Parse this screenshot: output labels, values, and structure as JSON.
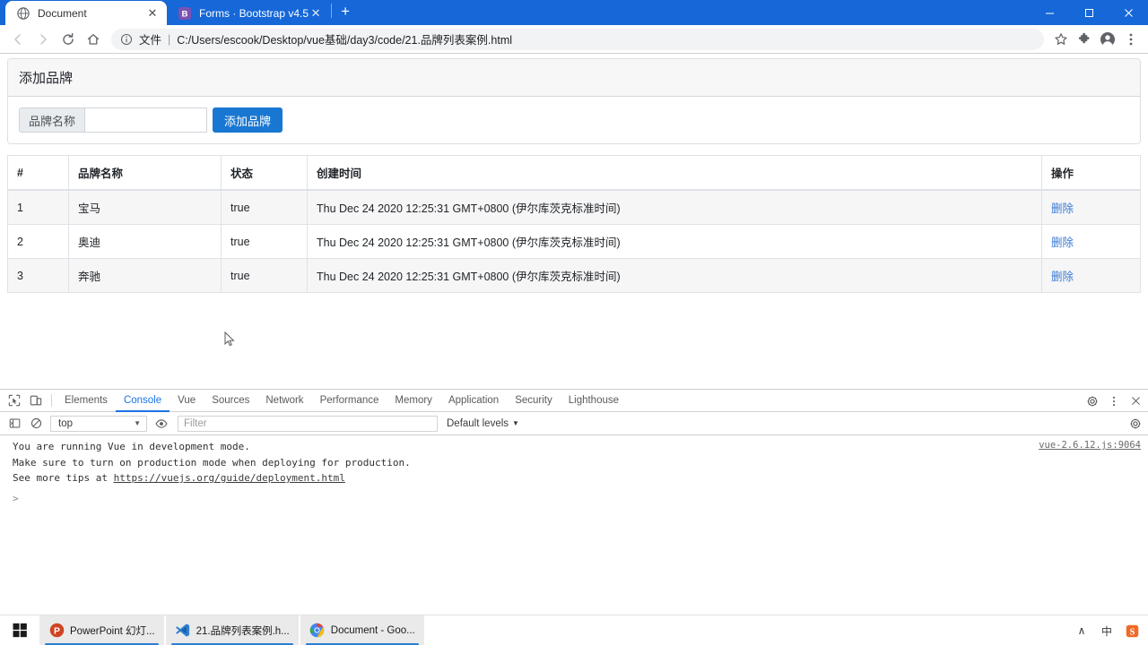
{
  "browser": {
    "tabs": [
      {
        "title": "Document",
        "favicon": "globe-icon",
        "active": true
      },
      {
        "title": "Forms · Bootstrap v4.5",
        "favicon": "bootstrap-icon",
        "active": false
      }
    ],
    "new_tab_label": "+",
    "window_controls": {
      "minimize": "–",
      "maximize": "❐",
      "close": "×"
    },
    "nav": {
      "back": "←",
      "forward": "→",
      "reload": "⟳",
      "home": "⌂"
    },
    "omnibox": {
      "scheme_label": "文件",
      "divider": "|",
      "url": "C:/Users/escook/Desktop/vue基础/day3/code/21.品牌列表案例.html"
    },
    "toolbar_icons": [
      "bookmark-star-icon",
      "extensions-puzzle-icon",
      "profile-avatar-icon",
      "chrome-menu-icon"
    ]
  },
  "page": {
    "card": {
      "header_title": "添加品牌",
      "input_label": "品牌名称",
      "input_value": "",
      "input_placeholder": "",
      "submit_label": "添加品牌"
    },
    "table": {
      "columns": [
        "#",
        "品牌名称",
        "状态",
        "创建时间",
        "操作"
      ],
      "action_label": "删除",
      "rows": [
        {
          "index": "1",
          "name": "宝马",
          "state": "true",
          "time": "Thu Dec 24 2020 12:25:31 GMT+0800 (伊尔库茨克标准时间)",
          "action": "删除"
        },
        {
          "index": "2",
          "name": "奥迪",
          "state": "true",
          "time": "Thu Dec 24 2020 12:25:31 GMT+0800 (伊尔库茨克标准时间)",
          "action": "删除"
        },
        {
          "index": "3",
          "name": "奔驰",
          "state": "true",
          "time": "Thu Dec 24 2020 12:25:31 GMT+0800 (伊尔库茨克标准时间)",
          "action": "删除"
        }
      ]
    }
  },
  "devtools": {
    "tabs": [
      {
        "label": "Elements",
        "active": false
      },
      {
        "label": "Console",
        "active": true
      },
      {
        "label": "Vue",
        "active": false
      },
      {
        "label": "Sources",
        "active": false
      },
      {
        "label": "Network",
        "active": false
      },
      {
        "label": "Performance",
        "active": false
      },
      {
        "label": "Memory",
        "active": false
      },
      {
        "label": "Application",
        "active": false
      },
      {
        "label": "Security",
        "active": false
      },
      {
        "label": "Lighthouse",
        "active": false
      }
    ],
    "header_icons": [
      "inspect-element-icon",
      "device-toolbar-icon"
    ],
    "right_icons": [
      "settings-gear-icon",
      "more-options-icon",
      "close-devtools-icon"
    ],
    "filterbar": {
      "sidebar_toggle": "console-sidebar-icon",
      "clear_label": "clear-console-icon",
      "context": "top",
      "eye_icon": "live-expression-eye-icon",
      "filter_placeholder": "Filter",
      "filter_value": "",
      "levels_label": "Default levels",
      "settings_icon": "console-settings-gear-icon"
    },
    "console": {
      "lines": [
        "You are running Vue in development mode.",
        "Make sure to turn on production mode when deploying for production.",
        "See more tips at "
      ],
      "link_text": "https://vuejs.org/guide/deployment.html",
      "source": "vue-2.6.12.js:9064",
      "prompt": ">"
    }
  },
  "taskbar": {
    "start_label": "start-button",
    "items": [
      {
        "label": "PowerPoint 幻灯...",
        "icon": "powerpoint-icon",
        "active": true
      },
      {
        "label": "21.品牌列表案例.h...",
        "icon": "vscode-icon",
        "active": true
      },
      {
        "label": "Document - Goo...",
        "icon": "chrome-icon",
        "active": true
      }
    ],
    "tray": [
      {
        "name": "show-hidden-icons-chevron",
        "glyph": "∧"
      },
      {
        "name": "ime-mode-icon",
        "glyph": "中"
      },
      {
        "name": "sogou-ime-icon",
        "glyph": "S"
      }
    ]
  },
  "colors": {
    "chrome_blue": "#1667d8",
    "primary": "#1877d2",
    "link_blue": "#3a7bd5",
    "devtools_active": "#1a73e8"
  }
}
